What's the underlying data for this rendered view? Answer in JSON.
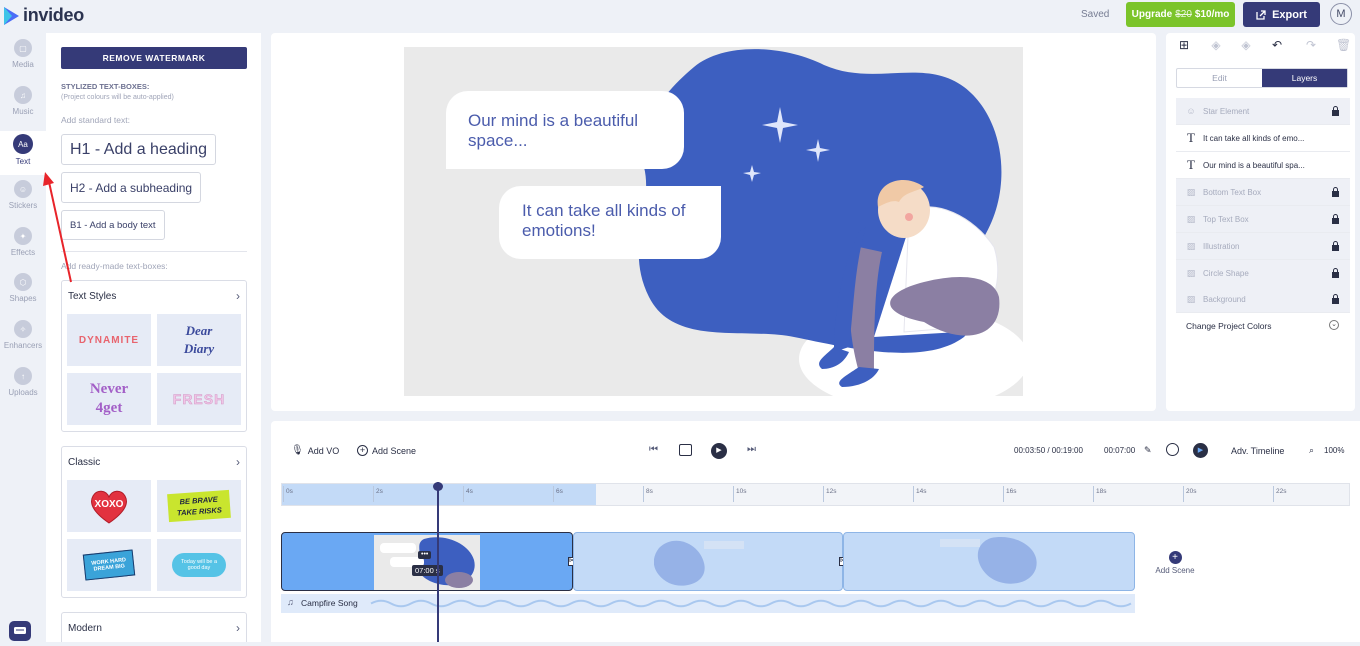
{
  "header": {
    "brand": "invideo",
    "status": "Saved",
    "upgrade_label": "Upgrade",
    "upgrade_old_price": "$20",
    "upgrade_price": "$10/mo",
    "export_label": "Export",
    "avatar_initial": "M"
  },
  "rail": [
    {
      "label": "Media",
      "icon": "image-icon"
    },
    {
      "label": "Music",
      "icon": "music-icon"
    },
    {
      "label": "Text",
      "icon": "text-icon",
      "icon_text": "Aa"
    },
    {
      "label": "Stickers",
      "icon": "sticker-icon"
    },
    {
      "label": "Effects",
      "icon": "effects-icon"
    },
    {
      "label": "Shapes",
      "icon": "shapes-icon"
    },
    {
      "label": "Enhancers",
      "icon": "enhancer-icon"
    },
    {
      "label": "Uploads",
      "icon": "upload-icon"
    }
  ],
  "text_panel": {
    "remove_watermark": "REMOVE WATERMARK",
    "stylized_title": "STYLIZED TEXT-BOXES:",
    "stylized_note": "(Project colours will be auto-applied)",
    "add_standard": "Add standard text:",
    "h1": "H1 - Add a heading",
    "h2": "H2 - Add a subheading",
    "b1": "B1 - Add a body text",
    "add_ready": "Add ready-made text-boxes:",
    "sections": [
      {
        "title": "Text Styles",
        "thumbs": [
          "DYNAMITE",
          "Dear Diary",
          "Never 4get",
          "FRESH"
        ]
      },
      {
        "title": "Classic",
        "thumbs": [
          "XOXO",
          "BE BRAVE TAKE RISKS",
          "WORK HARD DREAM BIG",
          "Today will be a good day"
        ]
      },
      {
        "title": "Modern"
      }
    ]
  },
  "canvas": {
    "bubble_top": "Our mind is a beautiful space...",
    "bubble_bottom": "It can take all kinds of emotions!"
  },
  "right_panel": {
    "tabs": [
      "Edit",
      "Layers"
    ],
    "active_tab": "Layers",
    "layers": [
      {
        "name": "Star Element",
        "locked": true,
        "kind": "sticker"
      },
      {
        "name": "It can take all kinds of emo...",
        "locked": false,
        "kind": "text"
      },
      {
        "name": "Our mind is a beautiful spa...",
        "locked": false,
        "kind": "text"
      },
      {
        "name": "Bottom Text Box",
        "locked": true,
        "kind": "image"
      },
      {
        "name": "Top Text Box",
        "locked": true,
        "kind": "image"
      },
      {
        "name": "Illustration",
        "locked": true,
        "kind": "image"
      },
      {
        "name": "Circle Shape",
        "locked": true,
        "kind": "image"
      },
      {
        "name": "Background",
        "locked": true,
        "kind": "image"
      }
    ],
    "change_colors": "Change Project Colors"
  },
  "timeline": {
    "add_vo": "Add VO",
    "add_scene": "Add Scene",
    "time_current": "00:03:50 / 00:19:00",
    "scene_duration": "00:07:00",
    "adv_timeline": "Adv. Timeline",
    "zoom": "100%",
    "ticks": [
      "0s",
      "2s",
      "4s",
      "6s",
      "8s",
      "10s",
      "12s",
      "14s",
      "16s",
      "18s",
      "20s",
      "22s"
    ],
    "clip_badge": "07:00 s",
    "add_scene_right": "Add Scene",
    "audio_track": "Campfire Song"
  },
  "colors": {
    "accent": "#353a78",
    "upgrade": "#7bc42a",
    "blob": "#3d5fc0",
    "clip": "#6aa8f3"
  }
}
